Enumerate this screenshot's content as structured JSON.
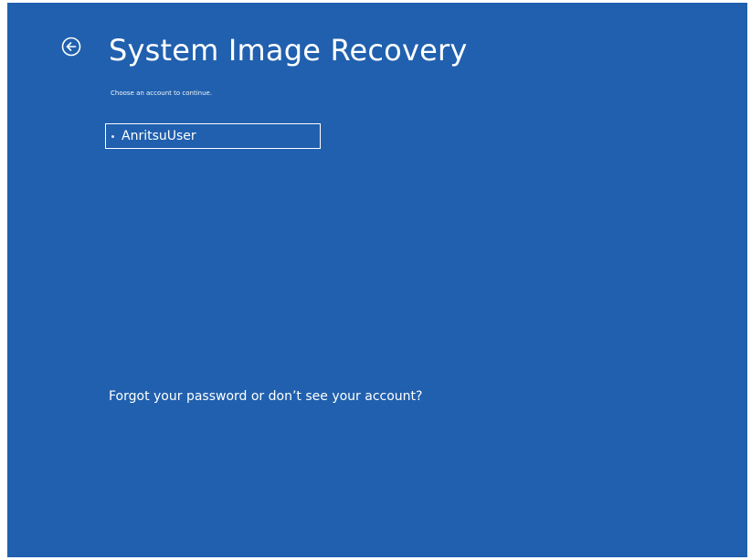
{
  "header": {
    "back_icon": "arrow-left-circle-icon",
    "title": "System Image Recovery",
    "subtitle": "Choose an account to continue."
  },
  "accounts": [
    {
      "label": "AnritsuUser",
      "selected": true
    }
  ],
  "footer": {
    "forgot_link": "Forgot your password or don’t see your account?"
  },
  "colors": {
    "background": "#2060ae",
    "text": "#ffffff"
  }
}
